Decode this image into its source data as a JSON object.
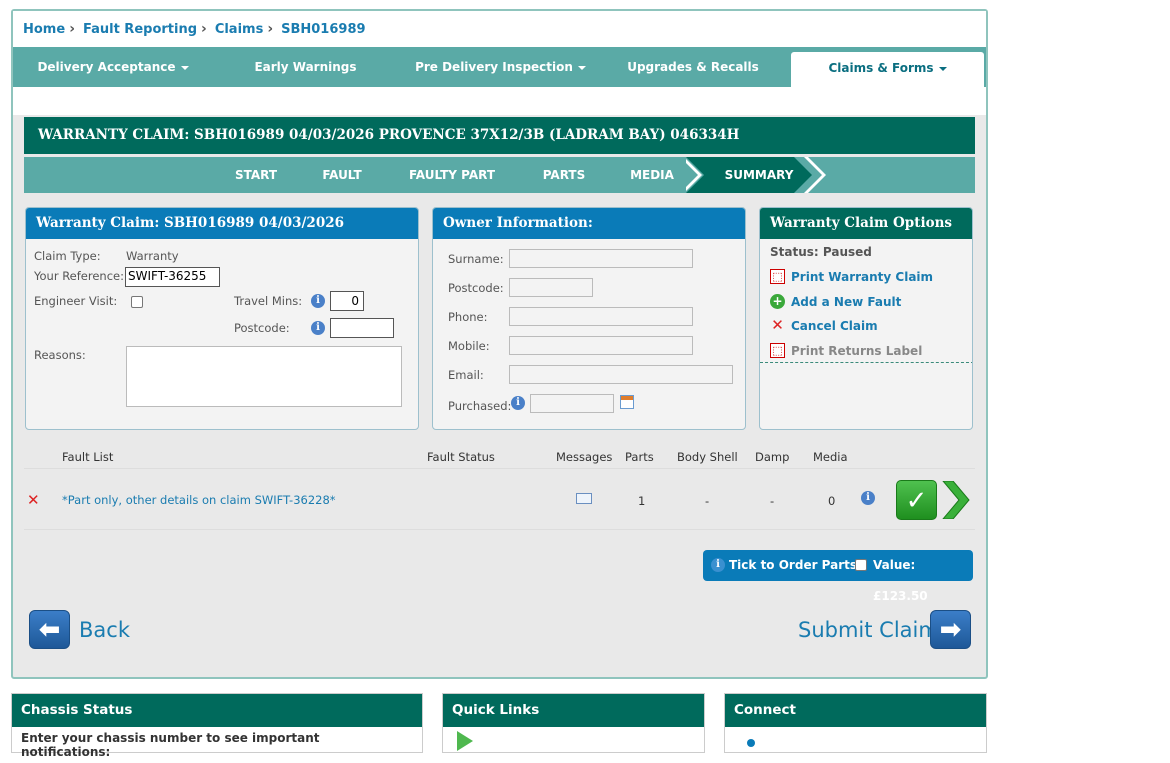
{
  "breadcrumb": [
    "Home",
    "Fault Reporting",
    "Claims",
    "SBH016989"
  ],
  "nav": [
    {
      "label": "Delivery Acceptance",
      "dropdown": true
    },
    {
      "label": "Early Warnings",
      "dropdown": false
    },
    {
      "label": "Pre Delivery Inspection",
      "dropdown": true
    },
    {
      "label": "Upgrades & Recalls",
      "dropdown": false
    },
    {
      "label": "Claims & Forms",
      "dropdown": true,
      "active": true
    }
  ],
  "title": "WARRANTY CLAIM: SBH016989 04/03/2026 PROVENCE 37X12/3B (LADRAM BAY) 046334H",
  "steps": [
    "START",
    "FAULT",
    "FAULTY PART",
    "PARTS",
    "MEDIA",
    "SUMMARY"
  ],
  "active_step": "SUMMARY",
  "claim": {
    "header": "Warranty Claim: SBH016989 04/03/2026",
    "claim_type_label": "Claim Type:",
    "claim_type_value": "Warranty",
    "reference_label": "Your Reference:",
    "reference_value": "SWIFT-36255",
    "engineer_label": "Engineer Visit:",
    "travel_label": "Travel Mins:",
    "travel_value": "0",
    "postcode_label": "Postcode:",
    "postcode_value": "",
    "reasons_label": "Reasons:",
    "reasons_value": ""
  },
  "owner": {
    "header": "Owner Information:",
    "surname_label": "Surname:",
    "postcode_label": "Postcode:",
    "phone_label": "Phone:",
    "mobile_label": "Mobile:",
    "email_label": "Email:",
    "purchased_label": "Purchased:"
  },
  "options": {
    "header": "Warranty Claim Options",
    "status": "Status: Paused",
    "items": [
      {
        "label": "Print Warranty Claim",
        "icon": "pdf-icon",
        "enabled": true
      },
      {
        "label": "Add a New Fault",
        "icon": "add-icon",
        "enabled": true
      },
      {
        "label": "Cancel Claim",
        "icon": "cancel-icon",
        "enabled": true
      },
      {
        "label": "Print Returns Label",
        "icon": "pdf-icon",
        "enabled": false
      }
    ]
  },
  "fault_table": {
    "headers": [
      "Fault List",
      "Fault Status",
      "Messages",
      "Parts",
      "Body Shell",
      "Damp",
      "Media"
    ],
    "rows": [
      {
        "description": "*Part only, other details on claim SWIFT-36228*",
        "status": "",
        "parts": "1",
        "body_shell": "-",
        "damp": "-",
        "media": "0"
      }
    ]
  },
  "order": {
    "label": "Tick to Order Parts:",
    "value": "Value: £123.50"
  },
  "actions": {
    "back": "Back",
    "submit": "Submit Claim"
  },
  "panels": {
    "chassis": "Chassis Status",
    "chassis_text": "Enter your chassis number to see important notifications:",
    "quick_links": "Quick Links",
    "connect": "Connect"
  },
  "colors": {
    "teal_dark": "#006a5c",
    "teal_light": "#5aaaa6",
    "blue": "#0a7bb8",
    "link": "#1a7cb0"
  }
}
